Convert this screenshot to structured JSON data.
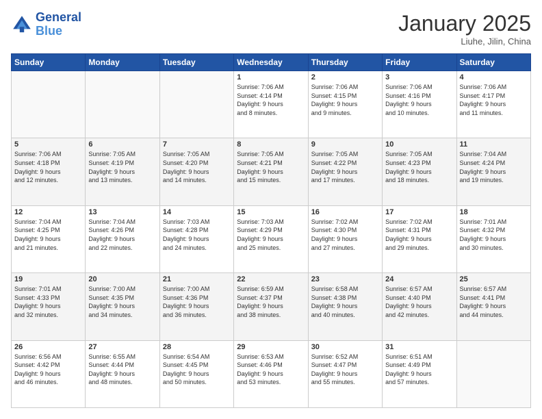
{
  "header": {
    "logo_line1": "General",
    "logo_line2": "Blue",
    "month": "January 2025",
    "location": "Liuhe, Jilin, China"
  },
  "weekdays": [
    "Sunday",
    "Monday",
    "Tuesday",
    "Wednesday",
    "Thursday",
    "Friday",
    "Saturday"
  ],
  "weeks": [
    [
      {
        "day": "",
        "info": ""
      },
      {
        "day": "",
        "info": ""
      },
      {
        "day": "",
        "info": ""
      },
      {
        "day": "1",
        "info": "Sunrise: 7:06 AM\nSunset: 4:14 PM\nDaylight: 9 hours\nand 8 minutes."
      },
      {
        "day": "2",
        "info": "Sunrise: 7:06 AM\nSunset: 4:15 PM\nDaylight: 9 hours\nand 9 minutes."
      },
      {
        "day": "3",
        "info": "Sunrise: 7:06 AM\nSunset: 4:16 PM\nDaylight: 9 hours\nand 10 minutes."
      },
      {
        "day": "4",
        "info": "Sunrise: 7:06 AM\nSunset: 4:17 PM\nDaylight: 9 hours\nand 11 minutes."
      }
    ],
    [
      {
        "day": "5",
        "info": "Sunrise: 7:06 AM\nSunset: 4:18 PM\nDaylight: 9 hours\nand 12 minutes."
      },
      {
        "day": "6",
        "info": "Sunrise: 7:05 AM\nSunset: 4:19 PM\nDaylight: 9 hours\nand 13 minutes."
      },
      {
        "day": "7",
        "info": "Sunrise: 7:05 AM\nSunset: 4:20 PM\nDaylight: 9 hours\nand 14 minutes."
      },
      {
        "day": "8",
        "info": "Sunrise: 7:05 AM\nSunset: 4:21 PM\nDaylight: 9 hours\nand 15 minutes."
      },
      {
        "day": "9",
        "info": "Sunrise: 7:05 AM\nSunset: 4:22 PM\nDaylight: 9 hours\nand 17 minutes."
      },
      {
        "day": "10",
        "info": "Sunrise: 7:05 AM\nSunset: 4:23 PM\nDaylight: 9 hours\nand 18 minutes."
      },
      {
        "day": "11",
        "info": "Sunrise: 7:04 AM\nSunset: 4:24 PM\nDaylight: 9 hours\nand 19 minutes."
      }
    ],
    [
      {
        "day": "12",
        "info": "Sunrise: 7:04 AM\nSunset: 4:25 PM\nDaylight: 9 hours\nand 21 minutes."
      },
      {
        "day": "13",
        "info": "Sunrise: 7:04 AM\nSunset: 4:26 PM\nDaylight: 9 hours\nand 22 minutes."
      },
      {
        "day": "14",
        "info": "Sunrise: 7:03 AM\nSunset: 4:28 PM\nDaylight: 9 hours\nand 24 minutes."
      },
      {
        "day": "15",
        "info": "Sunrise: 7:03 AM\nSunset: 4:29 PM\nDaylight: 9 hours\nand 25 minutes."
      },
      {
        "day": "16",
        "info": "Sunrise: 7:02 AM\nSunset: 4:30 PM\nDaylight: 9 hours\nand 27 minutes."
      },
      {
        "day": "17",
        "info": "Sunrise: 7:02 AM\nSunset: 4:31 PM\nDaylight: 9 hours\nand 29 minutes."
      },
      {
        "day": "18",
        "info": "Sunrise: 7:01 AM\nSunset: 4:32 PM\nDaylight: 9 hours\nand 30 minutes."
      }
    ],
    [
      {
        "day": "19",
        "info": "Sunrise: 7:01 AM\nSunset: 4:33 PM\nDaylight: 9 hours\nand 32 minutes."
      },
      {
        "day": "20",
        "info": "Sunrise: 7:00 AM\nSunset: 4:35 PM\nDaylight: 9 hours\nand 34 minutes."
      },
      {
        "day": "21",
        "info": "Sunrise: 7:00 AM\nSunset: 4:36 PM\nDaylight: 9 hours\nand 36 minutes."
      },
      {
        "day": "22",
        "info": "Sunrise: 6:59 AM\nSunset: 4:37 PM\nDaylight: 9 hours\nand 38 minutes."
      },
      {
        "day": "23",
        "info": "Sunrise: 6:58 AM\nSunset: 4:38 PM\nDaylight: 9 hours\nand 40 minutes."
      },
      {
        "day": "24",
        "info": "Sunrise: 6:57 AM\nSunset: 4:40 PM\nDaylight: 9 hours\nand 42 minutes."
      },
      {
        "day": "25",
        "info": "Sunrise: 6:57 AM\nSunset: 4:41 PM\nDaylight: 9 hours\nand 44 minutes."
      }
    ],
    [
      {
        "day": "26",
        "info": "Sunrise: 6:56 AM\nSunset: 4:42 PM\nDaylight: 9 hours\nand 46 minutes."
      },
      {
        "day": "27",
        "info": "Sunrise: 6:55 AM\nSunset: 4:44 PM\nDaylight: 9 hours\nand 48 minutes."
      },
      {
        "day": "28",
        "info": "Sunrise: 6:54 AM\nSunset: 4:45 PM\nDaylight: 9 hours\nand 50 minutes."
      },
      {
        "day": "29",
        "info": "Sunrise: 6:53 AM\nSunset: 4:46 PM\nDaylight: 9 hours\nand 53 minutes."
      },
      {
        "day": "30",
        "info": "Sunrise: 6:52 AM\nSunset: 4:47 PM\nDaylight: 9 hours\nand 55 minutes."
      },
      {
        "day": "31",
        "info": "Sunrise: 6:51 AM\nSunset: 4:49 PM\nDaylight: 9 hours\nand 57 minutes."
      },
      {
        "day": "",
        "info": ""
      }
    ]
  ]
}
